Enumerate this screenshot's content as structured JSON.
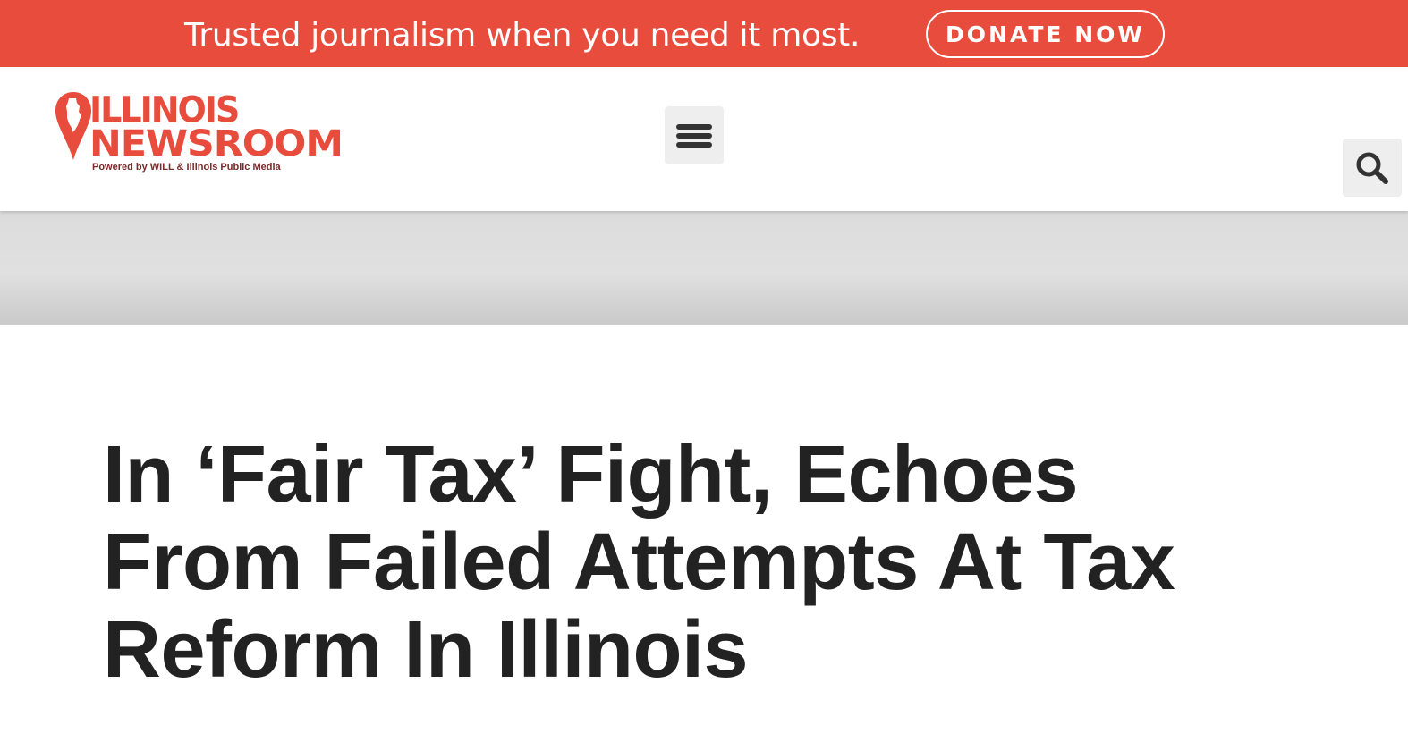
{
  "banner": {
    "message": "Trusted journalism when you need it most.",
    "donate_label": "DONATE NOW",
    "background_color": "#e84c3d"
  },
  "header": {
    "logo": {
      "line1": "ILLINOIS",
      "line2": "NEWSROOM",
      "tagline": "Powered by WILL & Illinois Public Media",
      "brand_color": "#e84c3d"
    },
    "menu_icon": "hamburger-menu-icon",
    "search_icon": "search-icon"
  },
  "article": {
    "title": "In ‘Fair Tax’ Fight, Echoes From Failed Attempts At Tax Reform In Illinois"
  }
}
